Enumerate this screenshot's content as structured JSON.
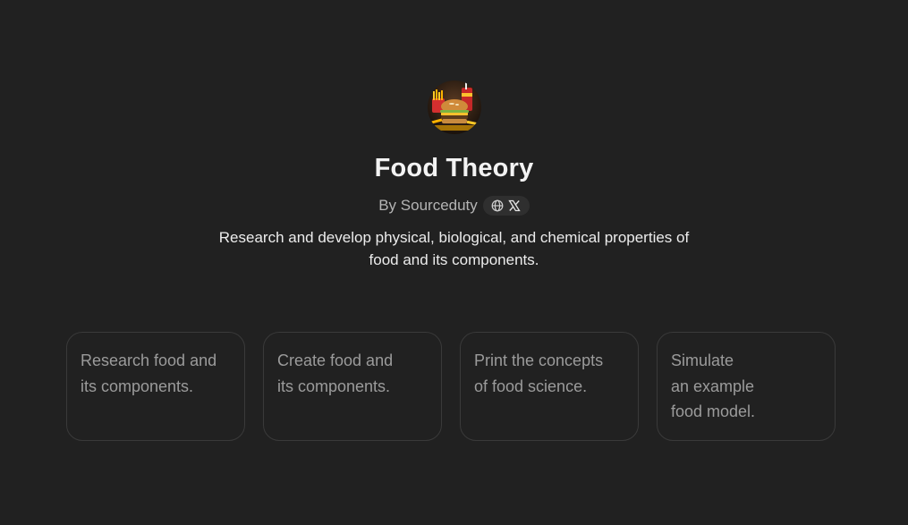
{
  "gpt": {
    "name": "Food Theory",
    "byline": "By Sourceduty",
    "description": "Research and develop physical, biological, and chemical properties of food and its components."
  },
  "icons": {
    "avatar": "burger-fries-soda-image",
    "website": "globe-icon",
    "twitter": "x-logo-icon"
  },
  "starters": [
    {
      "lines": [
        "Research food and",
        "its components."
      ]
    },
    {
      "lines": [
        "Create food and",
        "its components."
      ]
    },
    {
      "lines": [
        "Print the concepts",
        "of food science."
      ]
    },
    {
      "lines": [
        "Simulate",
        "an example",
        "food model."
      ]
    }
  ],
  "colors": {
    "background": "#212121",
    "card_border": "#3a3a3a",
    "muted_text": "#9b9b9b"
  }
}
